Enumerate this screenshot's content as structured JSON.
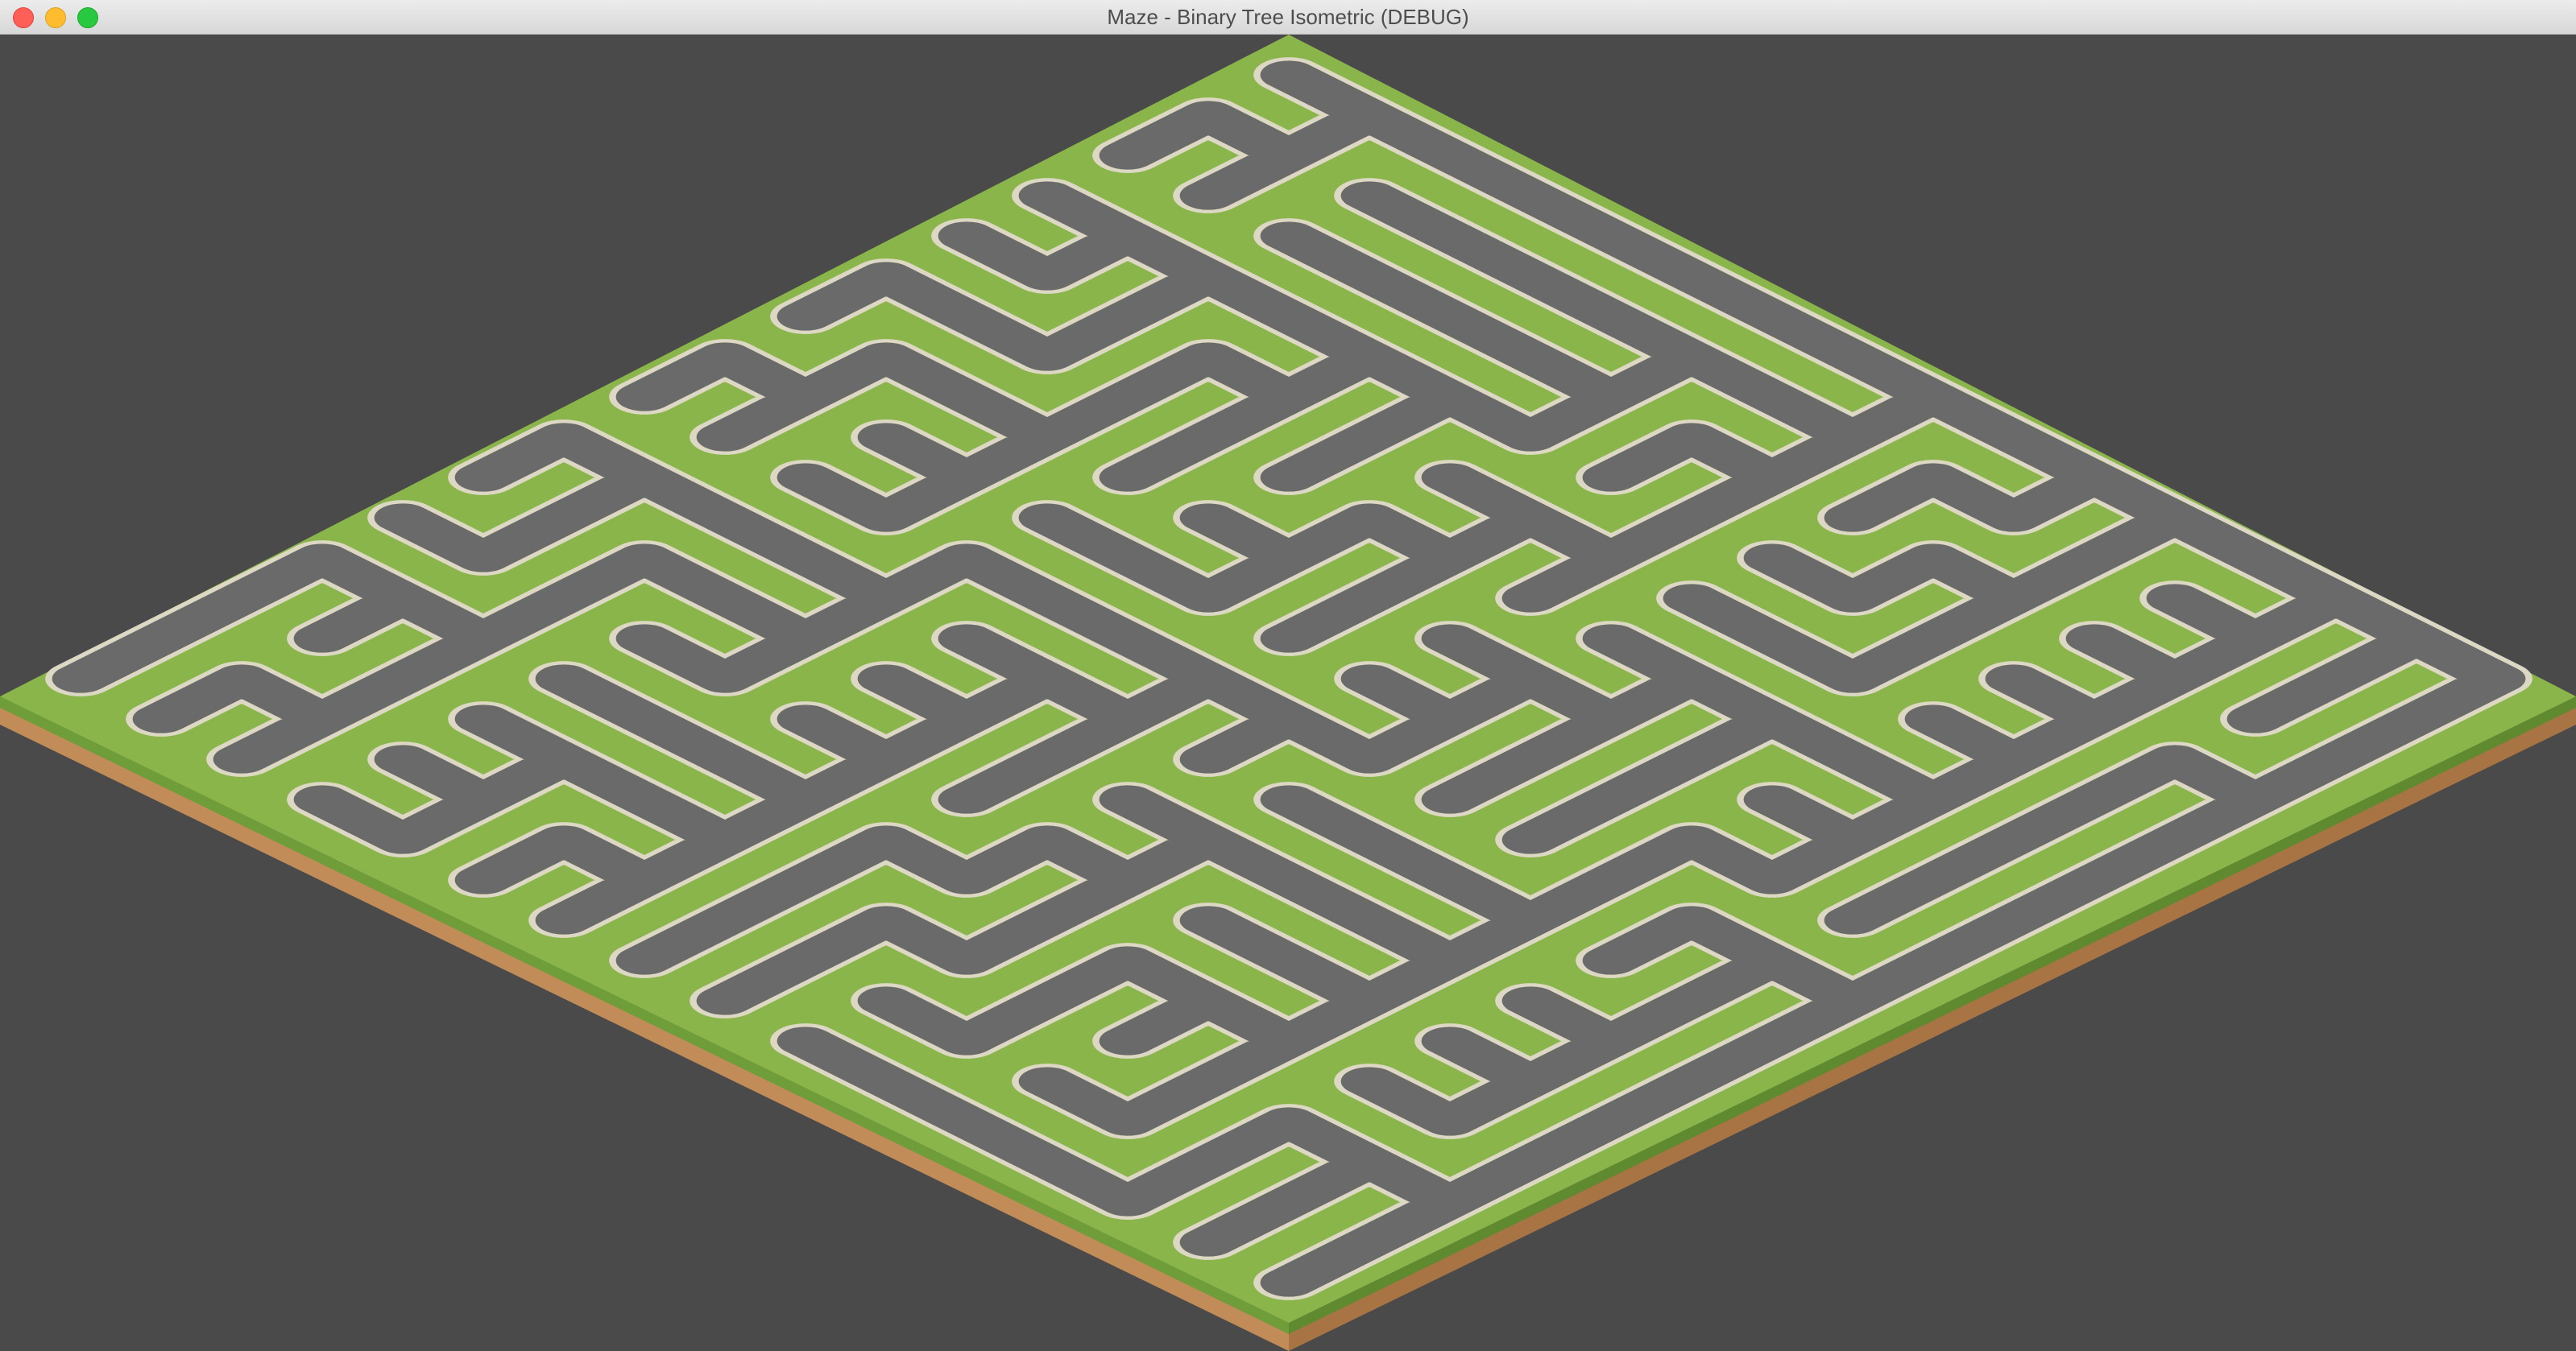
{
  "window": {
    "title": "Maze - Binary Tree Isometric (DEBUG)"
  },
  "icons": {
    "close": "close-icon",
    "minimize": "minimize-icon",
    "zoom": "zoom-icon"
  },
  "colors": {
    "background": "#4a4a4a",
    "grass_top": "#8ab54b",
    "grass_edge_left": "#6f9d3a",
    "grass_edge_right": "#5f8a30",
    "dirt_left": "#c28c58",
    "dirt_right": "#a87443",
    "road": "#6a6a6a",
    "road_line": "#ddd8c4"
  }
}
